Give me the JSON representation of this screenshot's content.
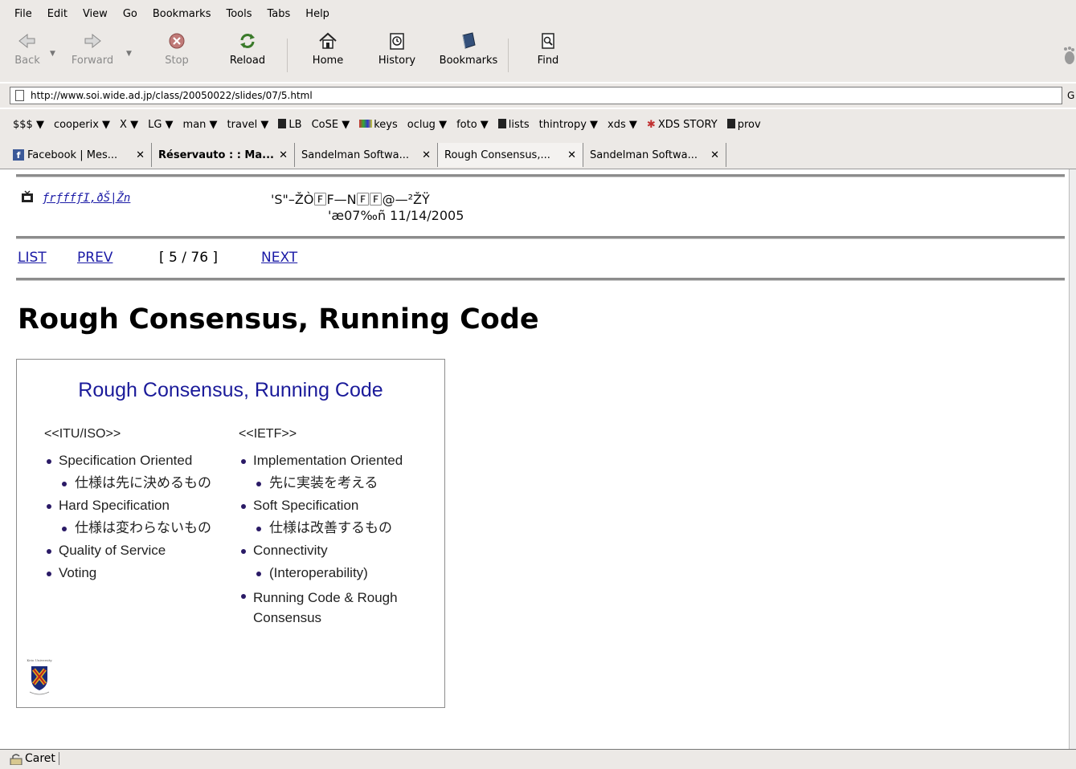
{
  "menu": {
    "items": [
      "File",
      "Edit",
      "View",
      "Go",
      "Bookmarks",
      "Tools",
      "Tabs",
      "Help"
    ]
  },
  "toolbar": {
    "back": "Back",
    "forward": "Forward",
    "stop": "Stop",
    "reload": "Reload",
    "home": "Home",
    "history": "History",
    "bookmarks": "Bookmarks",
    "find": "Find"
  },
  "address": {
    "url": "http://www.soi.wide.ad.jp/class/20050022/slides/07/5.html",
    "go_fragment": "G"
  },
  "bookmarks_bar": {
    "items": [
      "$$$ ▼",
      "cooperix ▼",
      "X ▼",
      "LG ▼",
      "man ▼",
      "travel ▼",
      "LB",
      "CoSE ▼",
      "keys",
      "oclug ▼",
      "foto ▼",
      "lists",
      "thintropy ▼",
      "xds ▼",
      "XDS STORY",
      "prov"
    ]
  },
  "tabs": [
    {
      "label": "Facebook | Mes...",
      "active": false
    },
    {
      "label": "Réservauto : : Ma...",
      "active": false
    },
    {
      "label": "Sandelman Softwa...",
      "active": false
    },
    {
      "label": "Rough Consensus,...",
      "active": true
    },
    {
      "label": "Sandelman Softwa...",
      "active": false
    }
  ],
  "page": {
    "home_link": "ƒrƒffƒI‚ðŠ|Žn",
    "header_title": "'S\"–ŽÒ🄵F—N🄵🄵@—²ŽŸ",
    "header_date": "'æ07‰ñ 11/14/2005",
    "nav_list": "LIST",
    "nav_prev": "PREV",
    "nav_position": "[ 5 / 76 ]",
    "nav_next": "NEXT",
    "title": "Rough Consensus, Running Code"
  },
  "slide": {
    "title": "Rough Consensus, Running Code",
    "left": {
      "heading": "<<ITU/ISO>>",
      "items": [
        {
          "text": "Specification Oriented",
          "level": 1
        },
        {
          "text": "仕様は先に決めるもの",
          "level": 2
        },
        {
          "text": "Hard Specification",
          "level": 1
        },
        {
          "text": "仕様は変わらないもの",
          "level": 2
        },
        {
          "text": "Quality of Service",
          "level": 1
        },
        {
          "text": "Voting",
          "level": 1
        }
      ]
    },
    "right": {
      "heading": "<<IETF>>",
      "items": [
        {
          "text": " Implementation Oriented",
          "level": 1
        },
        {
          "text": "先に実装を考える",
          "level": 2
        },
        {
          "text": "Soft Specification",
          "level": 1
        },
        {
          "text": "仕様は改善するもの",
          "level": 2
        },
        {
          "text": "Connectivity",
          "level": 1
        },
        {
          "text": "(Interoperability)",
          "level": 2
        },
        {
          "text": "Running Code & Rough Consensus",
          "level": 1
        }
      ]
    },
    "crest_caption": "Keio University"
  },
  "status": {
    "text": "Caret"
  },
  "colors": {
    "chrome": "#ece9e6",
    "link": "#1a1aa6",
    "slide_title": "#1b1b9a"
  }
}
